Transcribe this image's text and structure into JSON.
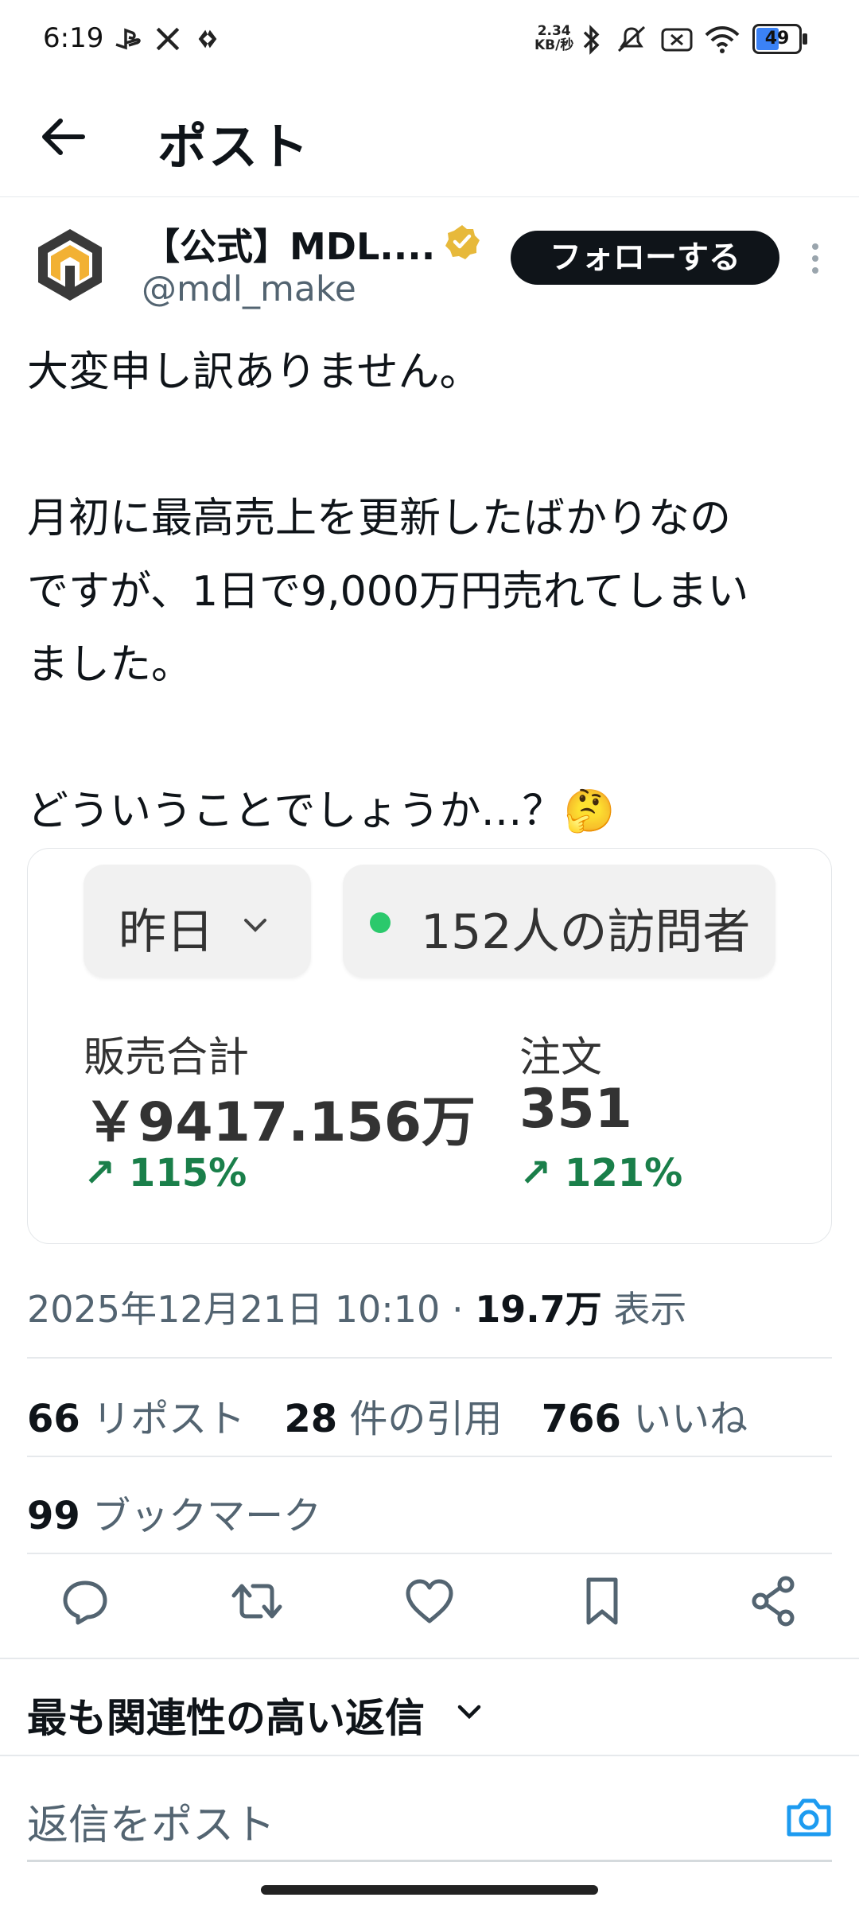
{
  "status_bar": {
    "time": "6:19",
    "net_speed_top": "2.34",
    "net_speed_bottom": "KB/秒",
    "battery": "49",
    "icons": [
      "playstation-icon",
      "x-icon",
      "app-icon",
      "bluetooth-icon",
      "mute-icon",
      "sim-icon",
      "wifi-icon",
      "battery-icon"
    ]
  },
  "header": {
    "title": "ポスト"
  },
  "author": {
    "name": "【公式】MDL....",
    "handle": "@mdl_make",
    "verified": true,
    "follow_label": "フォローする"
  },
  "post": {
    "paragraphs": [
      "大変申し訳ありません。",
      "",
      "月初に最高売上を更新したばかりなの",
      "ですが、1日で9,000万円売れてしまい",
      "ました。",
      "",
      "どういうことでしょうか…？🤔"
    ]
  },
  "media": {
    "period": "昨日",
    "visitors": "152人の訪問者",
    "sales_label": "販売合計",
    "sales_value": "￥9417.156万",
    "sales_change": "↗ 115%",
    "orders_label": "注文",
    "orders_value": "351",
    "orders_change": "↗ 121%",
    "accent_color": "#1a7f4a"
  },
  "meta": {
    "date": "2025年12月21日 10:10",
    "views_count": "19.7万",
    "views_label": "表示"
  },
  "engagement": {
    "reposts_count": "66",
    "reposts_label": "リポスト",
    "quotes_count": "28",
    "quotes_label": "件の引用",
    "likes_count": "766",
    "likes_label": "いいね",
    "bookmarks_count": "99",
    "bookmarks_label": "ブックマーク"
  },
  "actions": [
    "reply-icon",
    "repost-icon",
    "like-icon",
    "bookmark-icon",
    "share-icon"
  ],
  "replies": {
    "sort_label": "最も関連性の高い返信",
    "input_placeholder": "返信をポスト"
  }
}
